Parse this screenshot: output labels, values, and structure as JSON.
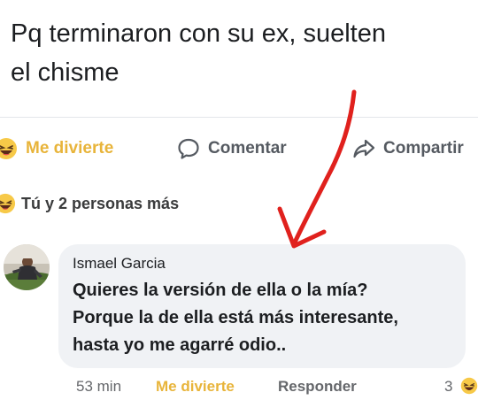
{
  "post": {
    "text_line1": "Pq terminaron con su ex, suelten",
    "text_line2": "el chisme"
  },
  "actions": {
    "react_label": "Me divierte",
    "comment_label": "Comentar",
    "share_label": "Compartir"
  },
  "reactions_summary": "Tú y 2 personas más",
  "comment": {
    "author": "Ismael Garcia",
    "line1": "Quieres la versión de ella o la mía?",
    "line2": "Porque la de ella está más interesante,",
    "line3": "hasta yo me agarré odio..",
    "time": "53 min",
    "react_label": "Me divierte",
    "reply_label": "Responder",
    "reaction_count": "3"
  },
  "colors": {
    "reaction_yellow": "#e8b43a",
    "annotation_red": "#e0211d",
    "bubble_gray": "#f0f2f5"
  },
  "icons": [
    "haha-emoji-icon",
    "comment-icon",
    "share-icon"
  ]
}
